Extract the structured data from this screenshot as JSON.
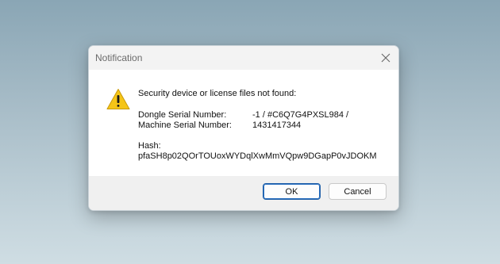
{
  "dialog": {
    "title": "Notification",
    "message": "Security device or license files not found:",
    "dongle_label": "Dongle Serial Number:",
    "dongle_value": "-1 / #C6Q7G4PXSL984 /",
    "machine_label": "Machine Serial Number:",
    "machine_value": "1431417344",
    "hash_label": "Hash:",
    "hash_value": "pfaSH8p02QOrTOUoxWYDqlXwMmVQpw9DGapP0vJDOKM",
    "icon": "warning-icon",
    "ok_label": "OK",
    "cancel_label": "Cancel"
  },
  "colors": {
    "warning": "#f5c518",
    "accent_border": "#1f5fa8"
  }
}
